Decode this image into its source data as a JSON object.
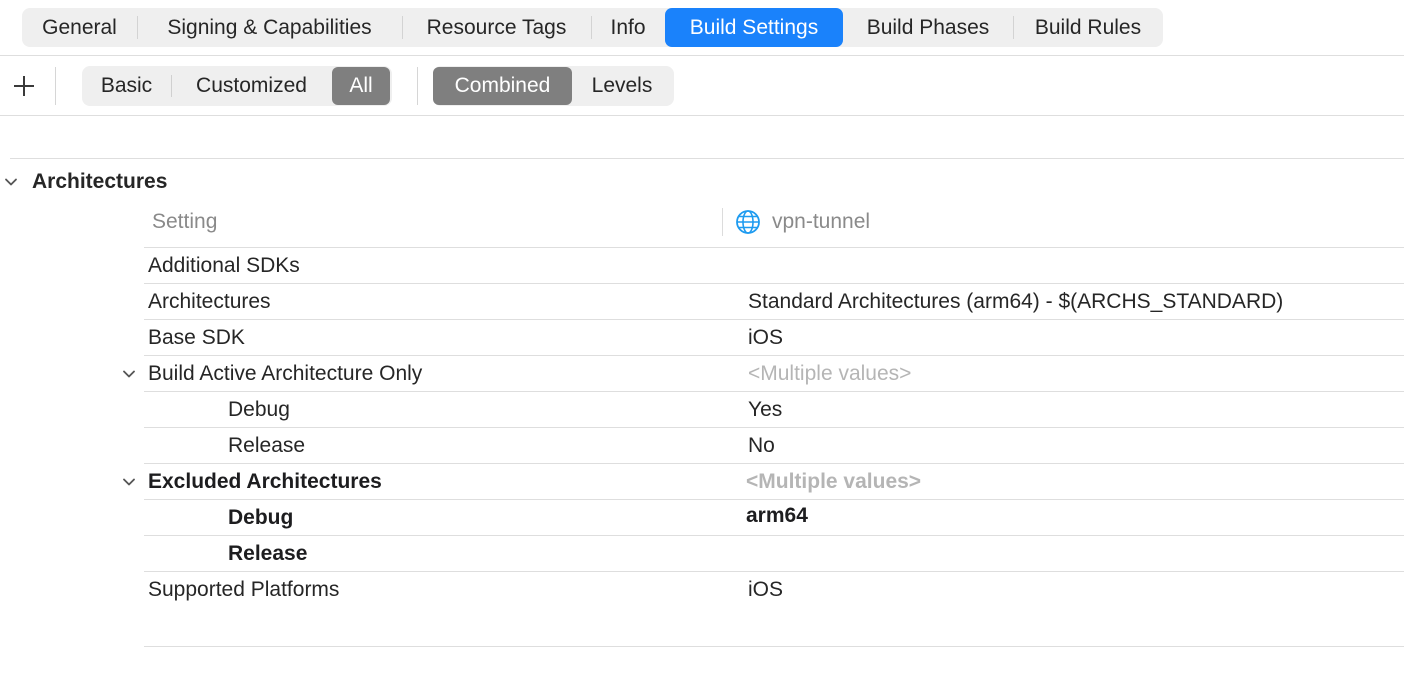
{
  "tabs": [
    {
      "label": "General",
      "active": false
    },
    {
      "label": "Signing & Capabilities",
      "active": false
    },
    {
      "label": "Resource Tags",
      "active": false
    },
    {
      "label": "Info",
      "active": false
    },
    {
      "label": "Build Settings",
      "active": true
    },
    {
      "label": "Build Phases",
      "active": false
    },
    {
      "label": "Build Rules",
      "active": false
    }
  ],
  "toolbar": {
    "add_icon": "plus-icon",
    "filter": {
      "basic": "Basic",
      "customized": "Customized",
      "all": "All",
      "selected": "All"
    },
    "view": {
      "combined": "Combined",
      "levels": "Levels",
      "selected": "Combined"
    }
  },
  "section": {
    "title": "Architectures",
    "expanded": true
  },
  "table": {
    "setting_header": "Setting",
    "target_name": "vpn-tunnel",
    "target_icon": "globe-icon",
    "rows": [
      {
        "name": "Additional SDKs",
        "value": ""
      },
      {
        "name": "Architectures",
        "value": "Standard Architectures (arm64)  -  $(ARCHS_STANDARD)"
      },
      {
        "name": "Base SDK",
        "value": "iOS"
      },
      {
        "name": "Build Active Architecture Only",
        "value": "<Multiple values>"
      },
      {
        "name": "Debug",
        "value": "Yes"
      },
      {
        "name": "Release",
        "value": "No"
      },
      {
        "name": "Excluded Architectures",
        "value": "<Multiple values>"
      },
      {
        "name": "Debug",
        "value": "arm64"
      },
      {
        "name": "Release",
        "value": ""
      },
      {
        "name": "Supported Platforms",
        "value": "iOS"
      }
    ]
  },
  "colors": {
    "accent": "#1a82fb",
    "segment_selected": "#7f7f7f",
    "muted_text": "#b5b5b5"
  }
}
